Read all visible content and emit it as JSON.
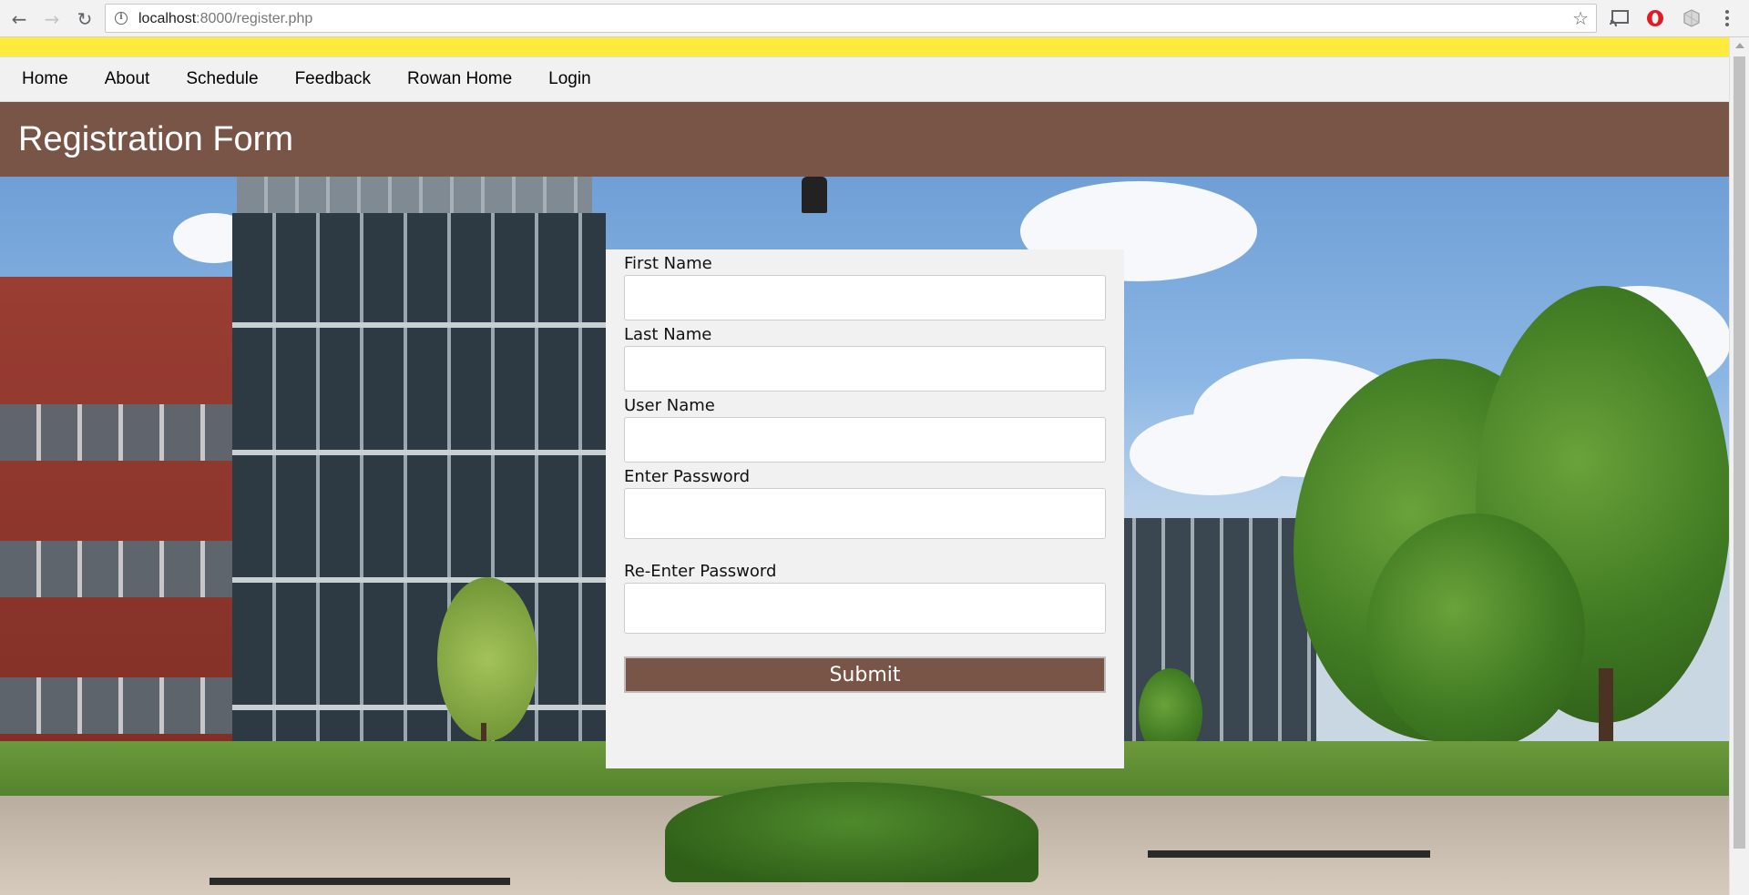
{
  "browser": {
    "url_host": "localhost",
    "url_rest": ":8000/register.php",
    "icons": [
      "back-icon",
      "forward-icon",
      "reload-icon",
      "info-icon",
      "star-icon",
      "cast-icon",
      "opera-icon",
      "extension-icon",
      "menu-icon"
    ]
  },
  "nav": {
    "items": [
      "Home",
      "About",
      "Schedule",
      "Feedback",
      "Rowan Home",
      "Login"
    ]
  },
  "header": {
    "title": "Registration Form"
  },
  "form": {
    "first_name_label": "First Name",
    "last_name_label": "Last Name",
    "user_name_label": "User Name",
    "password_label": "Enter Password",
    "reenter_password_label": "Re-Enter Password",
    "first_name_value": "",
    "last_name_value": "",
    "user_name_value": "",
    "password_value": "",
    "reenter_password_value": "",
    "submit_label": "Submit"
  },
  "colors": {
    "accent": "#795548",
    "yellow_bar": "#ffeb3b",
    "nav_bg": "#f1f1f1"
  }
}
